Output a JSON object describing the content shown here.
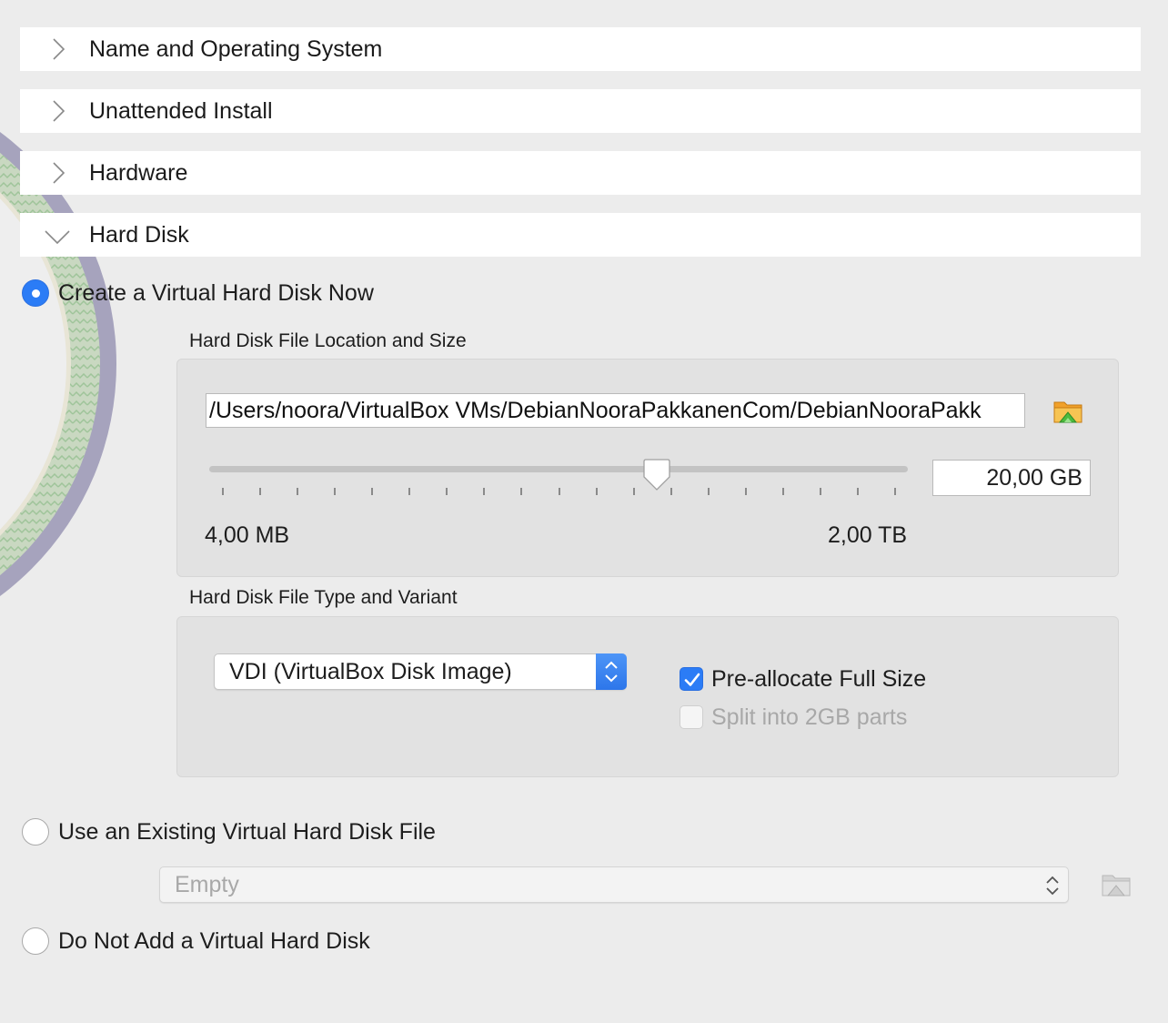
{
  "sections": [
    {
      "label": "Name and Operating System",
      "expanded": false
    },
    {
      "label": "Unattended Install",
      "expanded": false
    },
    {
      "label": "Hardware",
      "expanded": false
    },
    {
      "label": "Hard Disk",
      "expanded": true
    }
  ],
  "hard_disk": {
    "options": {
      "create": {
        "label": "Create a Virtual Hard Disk Now",
        "selected": true
      },
      "existing": {
        "label": "Use an Existing Virtual Hard Disk File",
        "selected": false
      },
      "none": {
        "label": "Do Not Add a Virtual Hard Disk",
        "selected": false
      }
    },
    "location_group_label": "Hard Disk File Location and Size",
    "file_path": "/Users/noora/VirtualBox VMs/DebianNooraPakkanenCom/DebianNooraPakk",
    "size": {
      "value": "20,00 GB",
      "min_label": "4,00 MB",
      "max_label": "2,00 TB",
      "slider_position": 0.64,
      "tick_count": 19
    },
    "type_group_label": "Hard Disk File Type and Variant",
    "file_type": "VDI (VirtualBox Disk Image)",
    "preallocate": {
      "label": "Pre-allocate Full Size",
      "checked": true
    },
    "split": {
      "label": "Split into 2GB parts",
      "checked": false,
      "enabled": false
    },
    "existing_file": {
      "value": "Empty"
    }
  },
  "icons": {
    "section_collapsed": "chevron-right-icon",
    "section_expanded": "chevron-down-icon",
    "folder": "folder-up-icon",
    "stepper": "up-down-stepper-icon"
  },
  "colors": {
    "accent": "#2b7cf6",
    "background": "#ececec",
    "panel": "#e2e2e2",
    "disabled_text": "#a8a8a8"
  }
}
